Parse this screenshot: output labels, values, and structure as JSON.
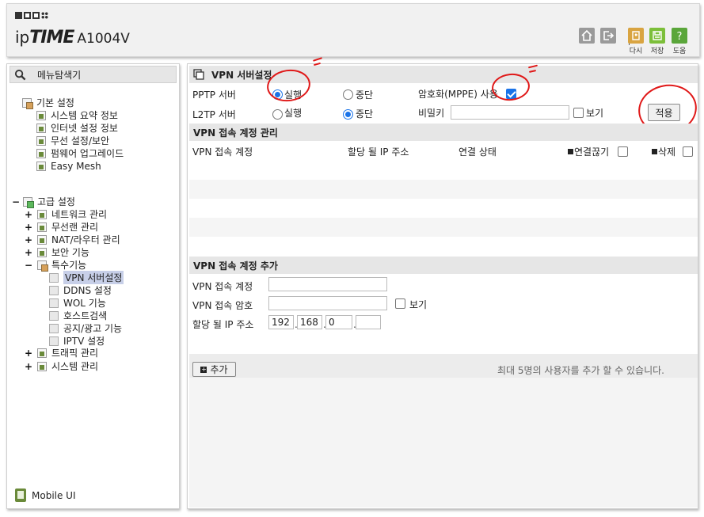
{
  "header": {
    "brand_ip": "ip",
    "brand_time": "TIME",
    "model": "A1004V",
    "buttons": [
      {
        "name": "home-icon",
        "label": ""
      },
      {
        "name": "logout-icon",
        "label": ""
      },
      {
        "name": "restart-icon",
        "label": "다시"
      },
      {
        "name": "save-icon",
        "label": "저장"
      },
      {
        "name": "help-icon",
        "label": "도움"
      }
    ],
    "colors": {
      "restart": "#d9a441",
      "save": "#7cbf3a",
      "help": "#5aa63a",
      "home": "#9a9a9a"
    }
  },
  "sidebar": {
    "title": "메뉴탐색기",
    "basic": {
      "label": "기본 설정",
      "items": [
        "시스템 요약 정보",
        "인터넷 설정 정보",
        "무선 설정/보안",
        "펌웨어 업그레이드",
        "Easy Mesh"
      ]
    },
    "advanced": {
      "toggle": "−",
      "label": "고급 설정",
      "items": [
        {
          "pm": "+",
          "label": "네트워크 관리"
        },
        {
          "pm": "+",
          "label": "무선랜 관리"
        },
        {
          "pm": "+",
          "label": "NAT/라우터 관리"
        },
        {
          "pm": "+",
          "label": "보안 기능"
        },
        {
          "pm": "−",
          "label": "특수기능"
        }
      ],
      "special_items": [
        "VPN 서버설정",
        "DDNS 설정",
        "WOL 기능",
        "호스트검색",
        "공지/광고 기능",
        "IPTV 설정"
      ],
      "tail_items": [
        {
          "pm": "+",
          "label": "트래픽 관리"
        },
        {
          "pm": "+",
          "label": "시스템 관리"
        }
      ]
    },
    "mobile_ui": "Mobile UI"
  },
  "main": {
    "title": "VPN 서버설정",
    "pptp": {
      "label": "PPTP 서버",
      "run": "실행",
      "stop": "중단",
      "state": "run"
    },
    "l2tp": {
      "label": "L2TP 서버",
      "run": "실행",
      "stop": "중단",
      "state": "stop"
    },
    "encryption": {
      "label": "암호화(MPPE) 사용",
      "checked": true
    },
    "secret": {
      "label": "비밀키",
      "value": "",
      "show_label": "보기"
    },
    "apply": "적용",
    "accounts": {
      "title": "VPN 접속 계정 관리",
      "columns": [
        "VPN 접속 계정",
        "할당 될 IP 주소",
        "연결 상태",
        "연결끊기",
        "삭제"
      ]
    },
    "add": {
      "title": "VPN 접속 계정 추가",
      "account_label": "VPN 접속 계정",
      "password_label": "VPN 접속 암호",
      "show_label": "보기",
      "ip_label": "할당 될 IP 주소",
      "ip": [
        "192",
        "168",
        "0",
        ""
      ],
      "add_button": "추가",
      "note": "최대 5명의 사용자를 추가 할 수 있습니다."
    }
  }
}
